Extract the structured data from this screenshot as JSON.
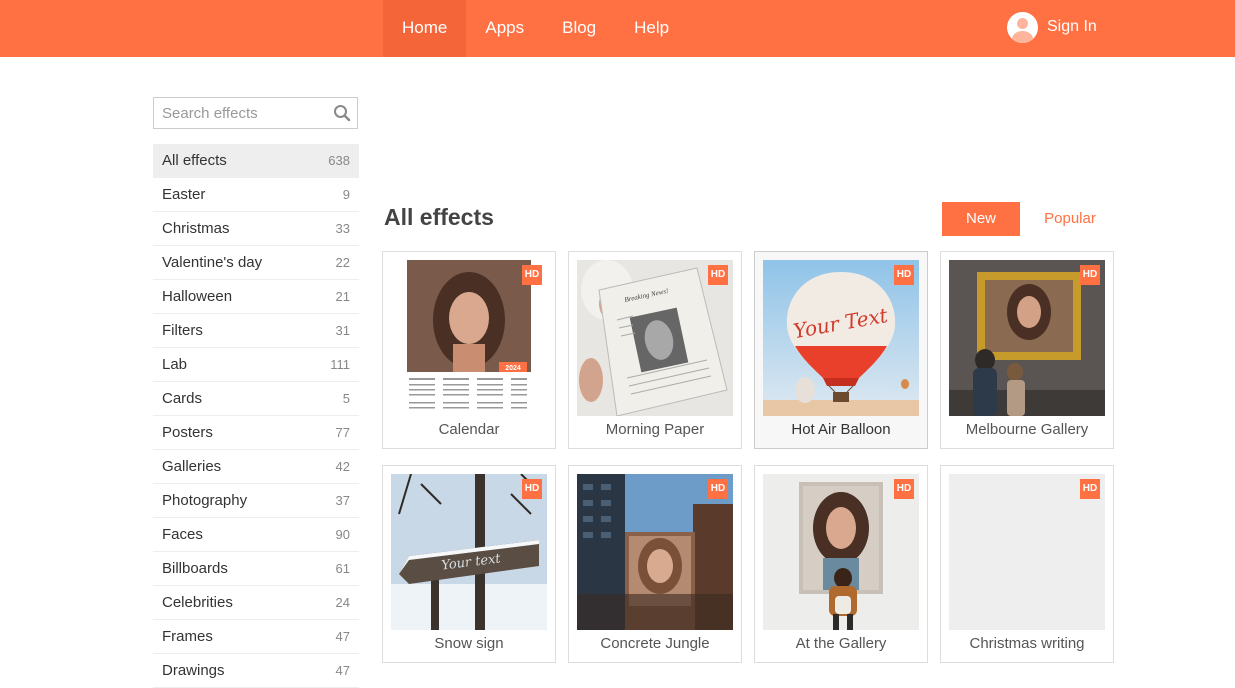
{
  "nav": {
    "items": [
      {
        "label": "Home",
        "active": true
      },
      {
        "label": "Apps",
        "active": false
      },
      {
        "label": "Blog",
        "active": false
      },
      {
        "label": "Help",
        "active": false
      }
    ],
    "signin_label": "Sign In",
    "accent": "#ff7043"
  },
  "search": {
    "placeholder": "Search effects",
    "value": ""
  },
  "categories": [
    {
      "label": "All effects",
      "count": "638"
    },
    {
      "label": "Easter",
      "count": "9"
    },
    {
      "label": "Christmas",
      "count": "33"
    },
    {
      "label": "Valentine's day",
      "count": "22"
    },
    {
      "label": "Halloween",
      "count": "21"
    },
    {
      "label": "Filters",
      "count": "31"
    },
    {
      "label": "Lab",
      "count": "111"
    },
    {
      "label": "Cards",
      "count": "5"
    },
    {
      "label": "Posters",
      "count": "77"
    },
    {
      "label": "Galleries",
      "count": "42"
    },
    {
      "label": "Photography",
      "count": "37"
    },
    {
      "label": "Faces",
      "count": "90"
    },
    {
      "label": "Billboards",
      "count": "61"
    },
    {
      "label": "Celebrities",
      "count": "24"
    },
    {
      "label": "Frames",
      "count": "47"
    },
    {
      "label": "Drawings",
      "count": "47"
    }
  ],
  "main": {
    "title": "All effects",
    "sort": {
      "new_label": "New",
      "popular_label": "Popular"
    }
  },
  "effects": [
    {
      "title": "Calendar",
      "badge": "HD",
      "calendar_year": "2024"
    },
    {
      "title": "Morning Paper",
      "badge": "HD",
      "paper_headline": "Breaking News!"
    },
    {
      "title": "Hot Air Balloon",
      "badge": "HD",
      "balloon_text": "Your Text"
    },
    {
      "title": "Melbourne Gallery",
      "badge": "HD"
    },
    {
      "title": "Snow sign",
      "badge": "HD",
      "sign_text": "Your text"
    },
    {
      "title": "Concrete Jungle",
      "badge": "HD"
    },
    {
      "title": "At the Gallery",
      "badge": "HD"
    },
    {
      "title": "Christmas writing",
      "badge": "HD"
    }
  ]
}
